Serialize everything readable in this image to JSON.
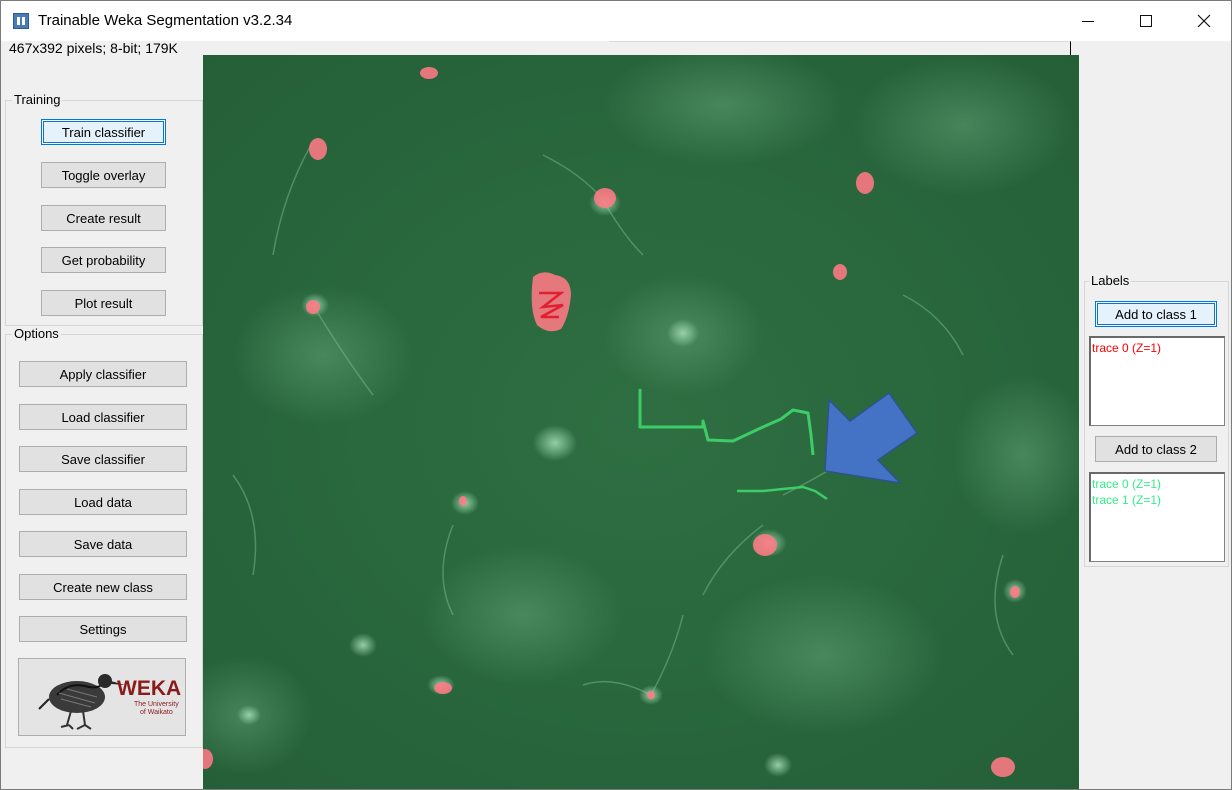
{
  "window": {
    "title": "Trainable Weka Segmentation v3.2.34",
    "image_info": "467x392 pixels; 8-bit; 179K"
  },
  "training": {
    "group_title": "Training",
    "buttons": [
      "Train classifier",
      "Toggle overlay",
      "Create result",
      "Get probability",
      "Plot result"
    ]
  },
  "options": {
    "group_title": "Options",
    "buttons": [
      "Apply classifier",
      "Load classifier",
      "Save classifier",
      "Load data",
      "Save data",
      "Create new class",
      "Settings"
    ]
  },
  "logo": {
    "text": "WEKA",
    "subtitle_1": "The University",
    "subtitle_2": "of Waikato"
  },
  "labels": {
    "group_title": "Labels",
    "class_1": {
      "button": "Add to class 1",
      "color": "#ff0000",
      "traces": [
        "trace 0 (Z=1)"
      ]
    },
    "class_2": {
      "button": "Add to class 2",
      "color": "#33ee88",
      "traces": [
        "trace 0 (Z=1)",
        "trace 1 (Z=1)"
      ]
    }
  },
  "colors": {
    "image_background": "#2b6b40",
    "class_1_overlay": "#ff6f7f",
    "class_2_trace": "#35c45e",
    "arrow": "#4472c4"
  }
}
